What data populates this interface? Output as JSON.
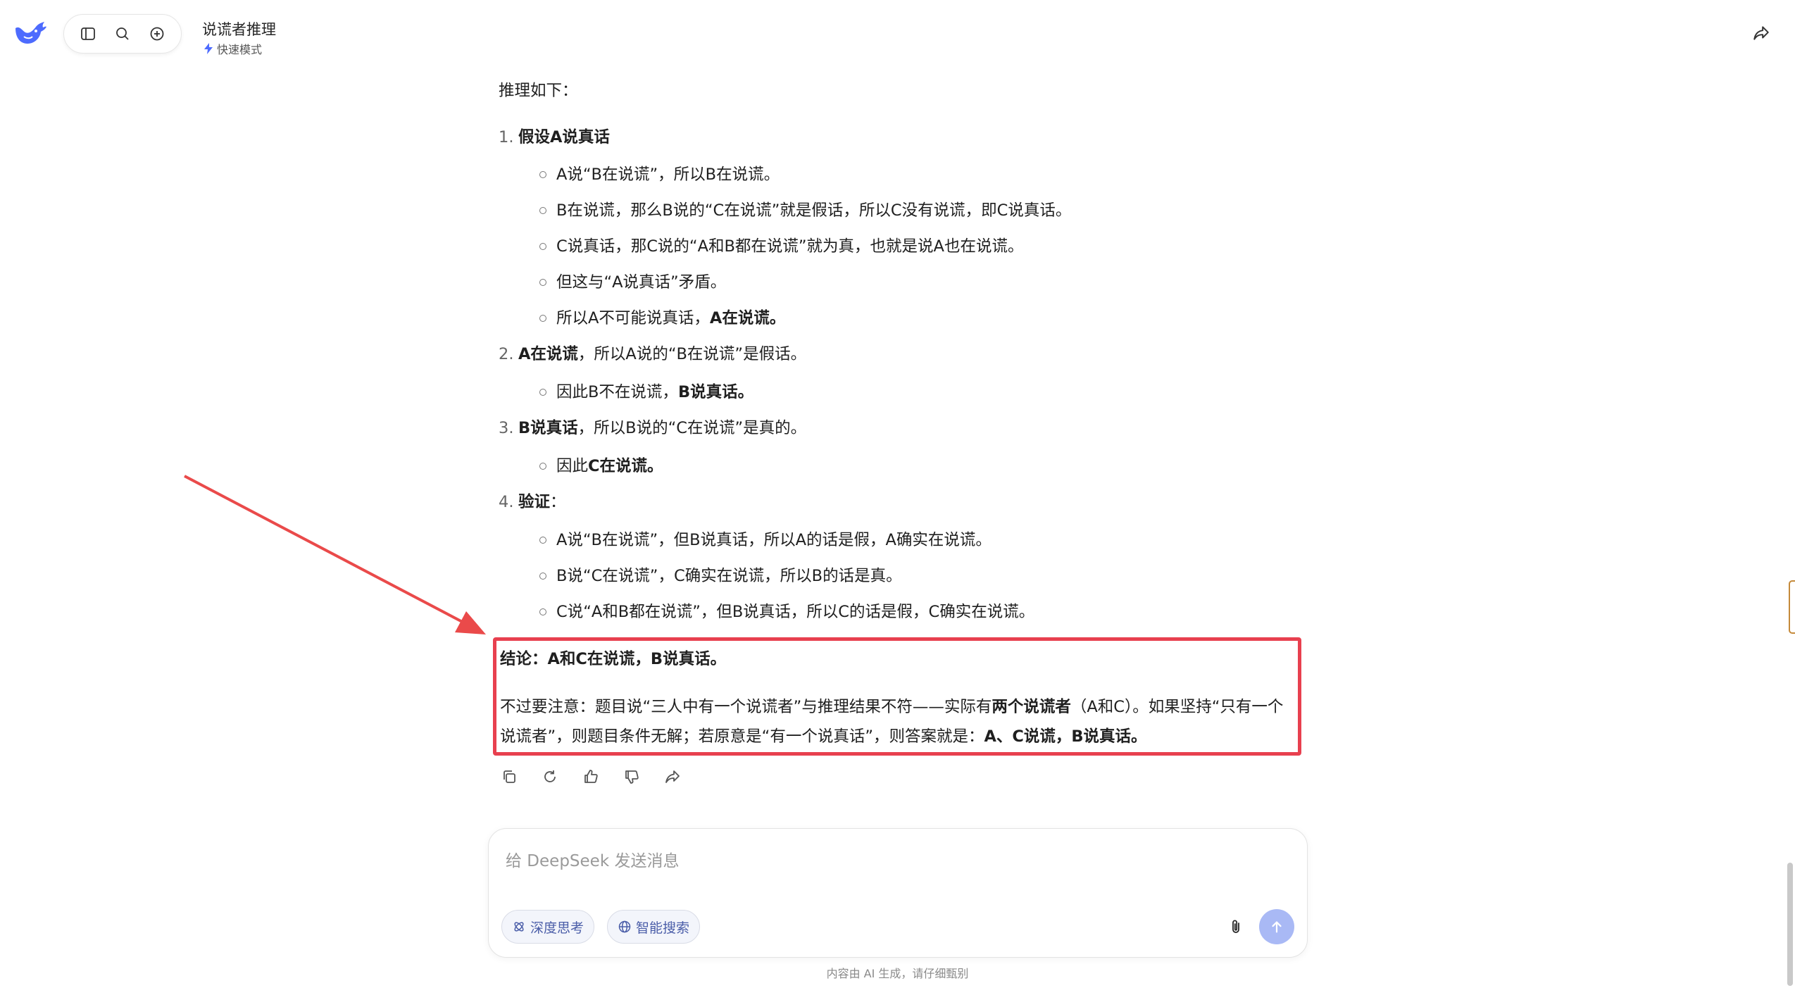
{
  "header": {
    "title": "说谎者推理",
    "mode_label": "快速模式"
  },
  "answer": {
    "intro": "推理如下：",
    "steps": [
      {
        "num": "1.",
        "title": "假设A说真话",
        "title_suffix": "",
        "bullets": [
          "A说“B在说谎”，所以B在说谎。",
          "B在说谎，那么B说的“C在说谎”就是假话，所以C没有说谎，即C说真话。",
          "C说真话，那C说的“A和B都在说谎”就为真，也就是说A也在说谎。",
          "但这与“A说真话”矛盾。"
        ],
        "bullet5_prefix": "所以A不可能说真话，",
        "bullet5_bold": "A在说谎。"
      },
      {
        "num": "2.",
        "title": "A在说谎",
        "title_suffix": "，所以A说的“B在说谎”是假话。",
        "bullet_prefix": "因此B不在说谎，",
        "bullet_bold": "B说真话。"
      },
      {
        "num": "3.",
        "title": "B说真话",
        "title_suffix": "，所以B说的“C在说谎”是真的。",
        "bullet_prefix": "因此",
        "bullet_bold": "C在说谎。"
      },
      {
        "num": "4.",
        "title": "验证",
        "title_suffix": "：",
        "bullets": [
          "A说“B在说谎”，但B说真话，所以A的话是假，A确实在说谎。",
          "B说“C在说谎”，C确实在说谎，所以B的话是真。",
          "C说“A和B都在说谎”，但B说真话，所以C的话是假，C确实在说谎。"
        ]
      }
    ],
    "conclusion": "结论：A和C在说谎，B说真话。",
    "note_part1": "不过要注意：题目说“三人中有一个说谎者”与推理结果不符——实际有",
    "note_bold1": "两个说谎者",
    "note_part2": "（A和C）。如果坚持“只有一个说谎者”，则题目条件无解；若原意是“有一个说真话”，则答案就是：",
    "note_bold2": "A、C说谎，B说真话。"
  },
  "composer": {
    "placeholder": "给 DeepSeek 发送消息",
    "deep_think_label": "深度思考",
    "web_search_label": "智能搜索"
  },
  "footer": {
    "disclaimer": "内容由 AI 生成，请仔细甄别"
  },
  "colors": {
    "accent": "#4d6bfe",
    "send_button": "#a9b9f5",
    "annotation_red": "#e8404f"
  }
}
